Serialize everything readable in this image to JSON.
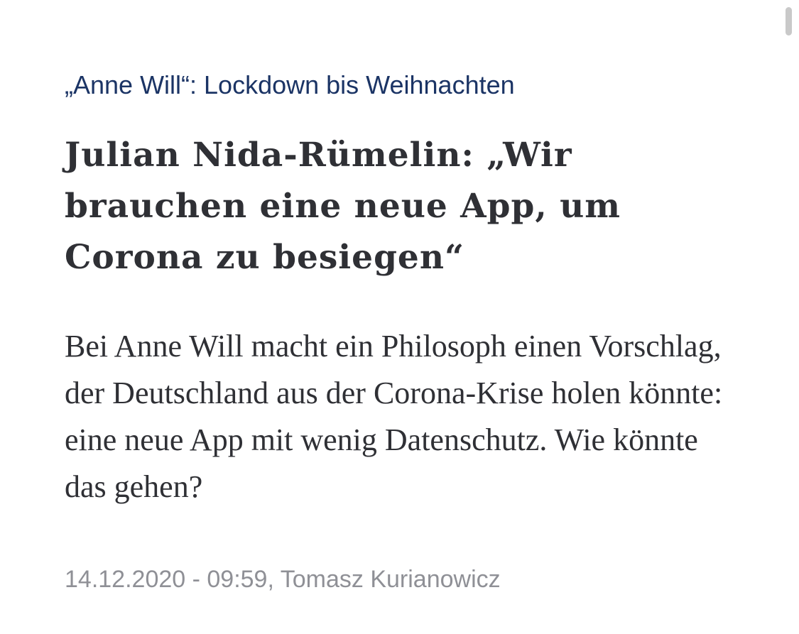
{
  "article": {
    "kicker": "„Anne Will“: Lockdown bis Weihnachten",
    "headline": "Julian Nida-Rümelin: „Wir brauchen eine neue App, um Corona zu besiegen“",
    "teaser": "Bei Anne Will macht ein Philosoph einen Vorschlag, der Deutschland aus der Corona-Krise holen könnte: eine neue App mit wenig Datenschutz. Wie könnte das gehen?",
    "date": "14.12.2020 - 09:59",
    "author": "Tomasz Kurianowicz"
  },
  "colors": {
    "kicker": "#1b3465",
    "headline": "#2f3035",
    "teaser": "#2f3035",
    "meta": "#8f9096",
    "background": "#ffffff"
  }
}
